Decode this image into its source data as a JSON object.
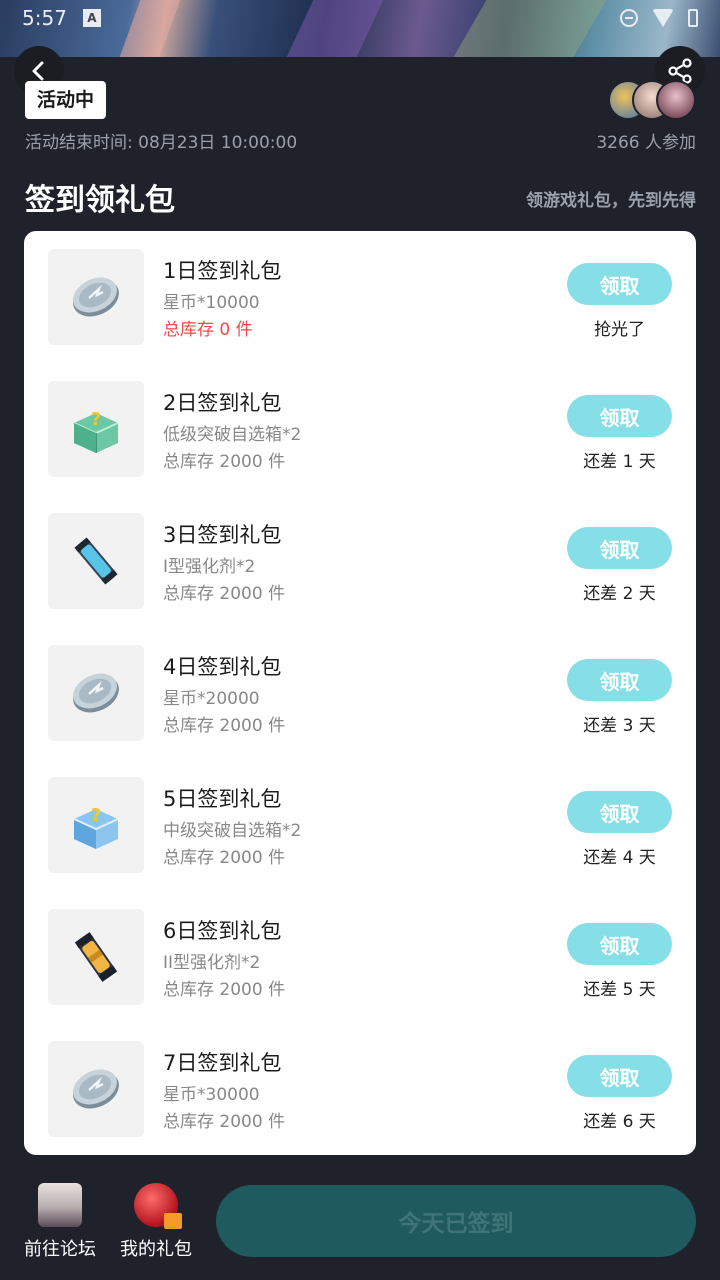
{
  "status_bar": {
    "time": "5:57",
    "a_icon": "A"
  },
  "activity": {
    "badge": "活动中",
    "end_time": "活动结束时间: 08月23日 10:00:00",
    "participants": "3266 人参加"
  },
  "section": {
    "title": "签到领礼包",
    "hint": "领游戏礼包，先到先得"
  },
  "gifts": [
    {
      "title": "1日签到礼包",
      "desc": "星币*10000",
      "stock": "总库存 0 件",
      "button": "领取",
      "status": "抢光了",
      "icon": "coin-icon",
      "sold_out": true
    },
    {
      "title": "2日签到礼包",
      "desc": "低级突破自选箱*2",
      "stock": "总库存 2000 件",
      "button": "领取",
      "status": "还差 1 天",
      "icon": "green-mystery-box-icon"
    },
    {
      "title": "3日签到礼包",
      "desc": "I型强化剂*2",
      "stock": "总库存 2000 件",
      "button": "领取",
      "status": "还差 2 天",
      "icon": "blue-canister-icon"
    },
    {
      "title": "4日签到礼包",
      "desc": "星币*20000",
      "stock": "总库存 2000 件",
      "button": "领取",
      "status": "还差 3 天",
      "icon": "coin-icon"
    },
    {
      "title": "5日签到礼包",
      "desc": "中级突破自选箱*2",
      "stock": "总库存 2000 件",
      "button": "领取",
      "status": "还差 4 天",
      "icon": "blue-mystery-box-icon"
    },
    {
      "title": "6日签到礼包",
      "desc": "II型强化剂*2",
      "stock": "总库存 2000 件",
      "button": "领取",
      "status": "还差 5 天",
      "icon": "gold-canister-icon"
    },
    {
      "title": "7日签到礼包",
      "desc": "星币*30000",
      "stock": "总库存 2000 件",
      "button": "领取",
      "status": "还差 6 天",
      "icon": "coin-icon"
    }
  ],
  "bottom": {
    "forum_label": "前往论坛",
    "my_gifts_label": "我的礼包",
    "signed_label": "今天已签到"
  },
  "colors": {
    "background": "#1f222b",
    "claim_button": "#86dfe6",
    "signed_button": "#1e5a5e",
    "sold_out_text": "#f24a4a"
  }
}
